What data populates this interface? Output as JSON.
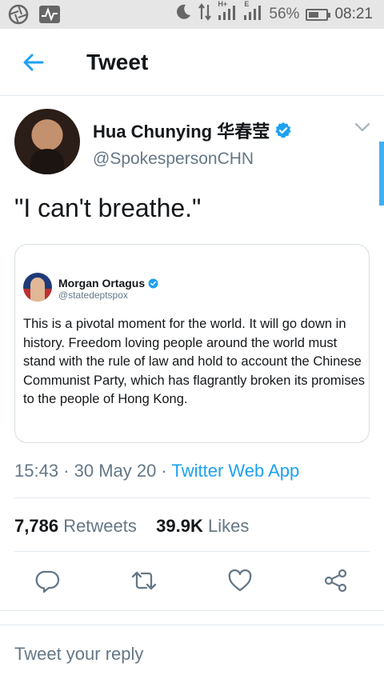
{
  "status_bar": {
    "battery_percent": "56%",
    "time": "08:21",
    "net_label_1": "H+",
    "net_label_2": "E"
  },
  "header": {
    "title": "Tweet"
  },
  "tweet": {
    "author_name": "Hua Chunying 华春莹",
    "author_handle": "@SpokespersonCHN",
    "text": "\"I can't breathe.\"",
    "timestamp": "15:43 · 30 May 20 · ",
    "source_app": "Twitter Web App",
    "retweets_count": "7,786",
    "retweets_label": "Retweets",
    "likes_count": "39.9K",
    "likes_label": "Likes"
  },
  "quoted_tweet": {
    "author_name": "Morgan Ortagus",
    "author_handle": "@statedeptspox",
    "text": "This is a pivotal moment for the world. It will go down in history. Freedom loving people around the world must stand with the rule of law and hold to account the Chinese Communist Party, which has flagrantly broken its promises to the people of Hong Kong."
  },
  "reply": {
    "placeholder": "Tweet your reply"
  },
  "colors": {
    "accent": "#1da1f2",
    "secondary_text": "#657786",
    "divider": "#e1e8ed"
  },
  "icons": [
    "back-arrow-icon",
    "verified-badge-icon",
    "chevron-down-icon",
    "reply-icon",
    "retweet-icon",
    "like-icon",
    "share-icon"
  ]
}
